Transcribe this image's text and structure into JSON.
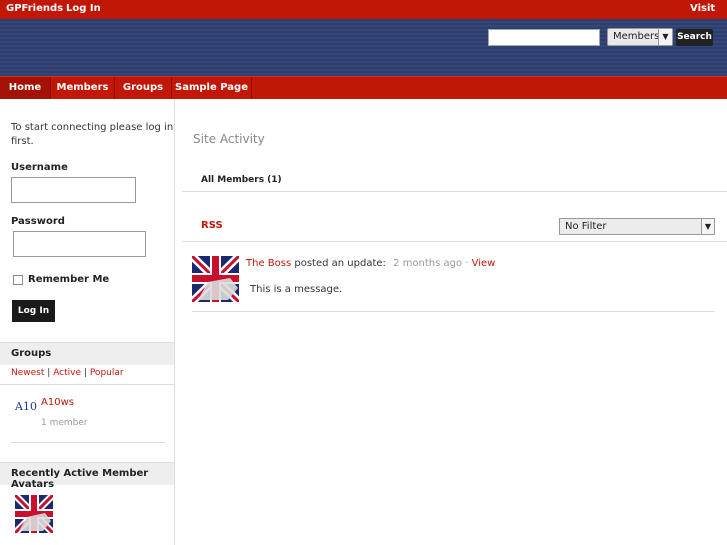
{
  "adminbar": {
    "site_name": "GPFriends",
    "login": "Log In",
    "visit": "Visit"
  },
  "search": {
    "placeholder": "",
    "scope_selected": "Members",
    "button": "Search"
  },
  "nav": {
    "items": [
      "Home",
      "Members",
      "Groups",
      "Sample Page"
    ]
  },
  "sidebar": {
    "intro": [
      "To start connecting please log in",
      "first."
    ],
    "username_label": "Username",
    "password_label": "Password",
    "remember_label": "Remember Me",
    "login_button": "Log In",
    "groups": {
      "title": "Groups",
      "filters": [
        "Newest",
        "Active",
        "Popular"
      ],
      "separator": "|",
      "items": [
        {
          "name": "A10ws",
          "meta": "1 member",
          "logo_text": "A10"
        }
      ]
    },
    "recent": {
      "title": "Recently Active Member Avatars"
    }
  },
  "main": {
    "title": "Site Activity",
    "tab": "All Members (1)",
    "rss": "RSS",
    "filter_selected": "No Filter",
    "activity": [
      {
        "user": "The Boss",
        "action": " posted an update:",
        "time": "2 months ago",
        "dot": " · ",
        "view": "View",
        "message": "This is a message."
      }
    ]
  },
  "colors": {
    "brand_red": "#c11707",
    "header_navy": "#2e3e6c"
  }
}
